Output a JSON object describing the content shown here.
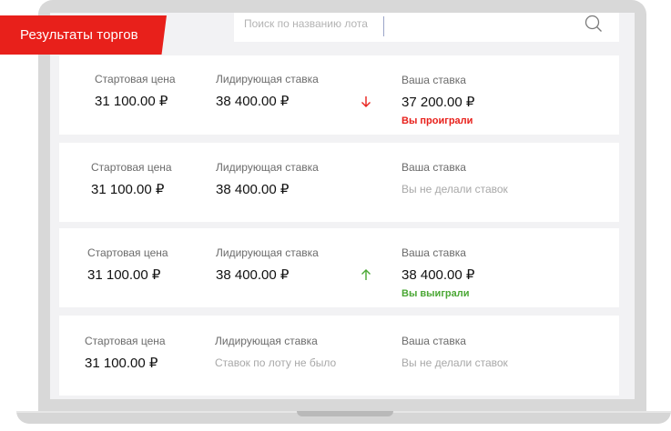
{
  "header": {
    "title": "Результаты торгов"
  },
  "search": {
    "placeholder": "Поиск по названию лота"
  },
  "labels": {
    "start_price": "Стартовая цена",
    "leading_bid": "Лидирующая ставка",
    "your_bid": "Ваша ставка"
  },
  "colors": {
    "accent": "#e8201b",
    "won": "#4aa734"
  },
  "lots": [
    {
      "start_price": "31 100.00 ₽",
      "leading_bid": "38 400.00 ₽",
      "trend_icon": "arrow-down-icon",
      "your_bid": "37 200.00 ₽",
      "status": "Вы проиграли"
    },
    {
      "start_price": "31 100.00 ₽",
      "leading_bid": "38 400.00 ₽",
      "your_bid_note": "Вы не делали ставок"
    },
    {
      "start_price": "31 100.00 ₽",
      "leading_bid": "38 400.00 ₽",
      "trend_icon": "arrow-up-icon",
      "your_bid": "38 400.00 ₽",
      "status": "Вы выиграли"
    },
    {
      "start_price": "31 100.00 ₽",
      "leading_bid_note": "Ставок по лоту не было",
      "your_bid_note": "Вы не делали ставок"
    }
  ]
}
